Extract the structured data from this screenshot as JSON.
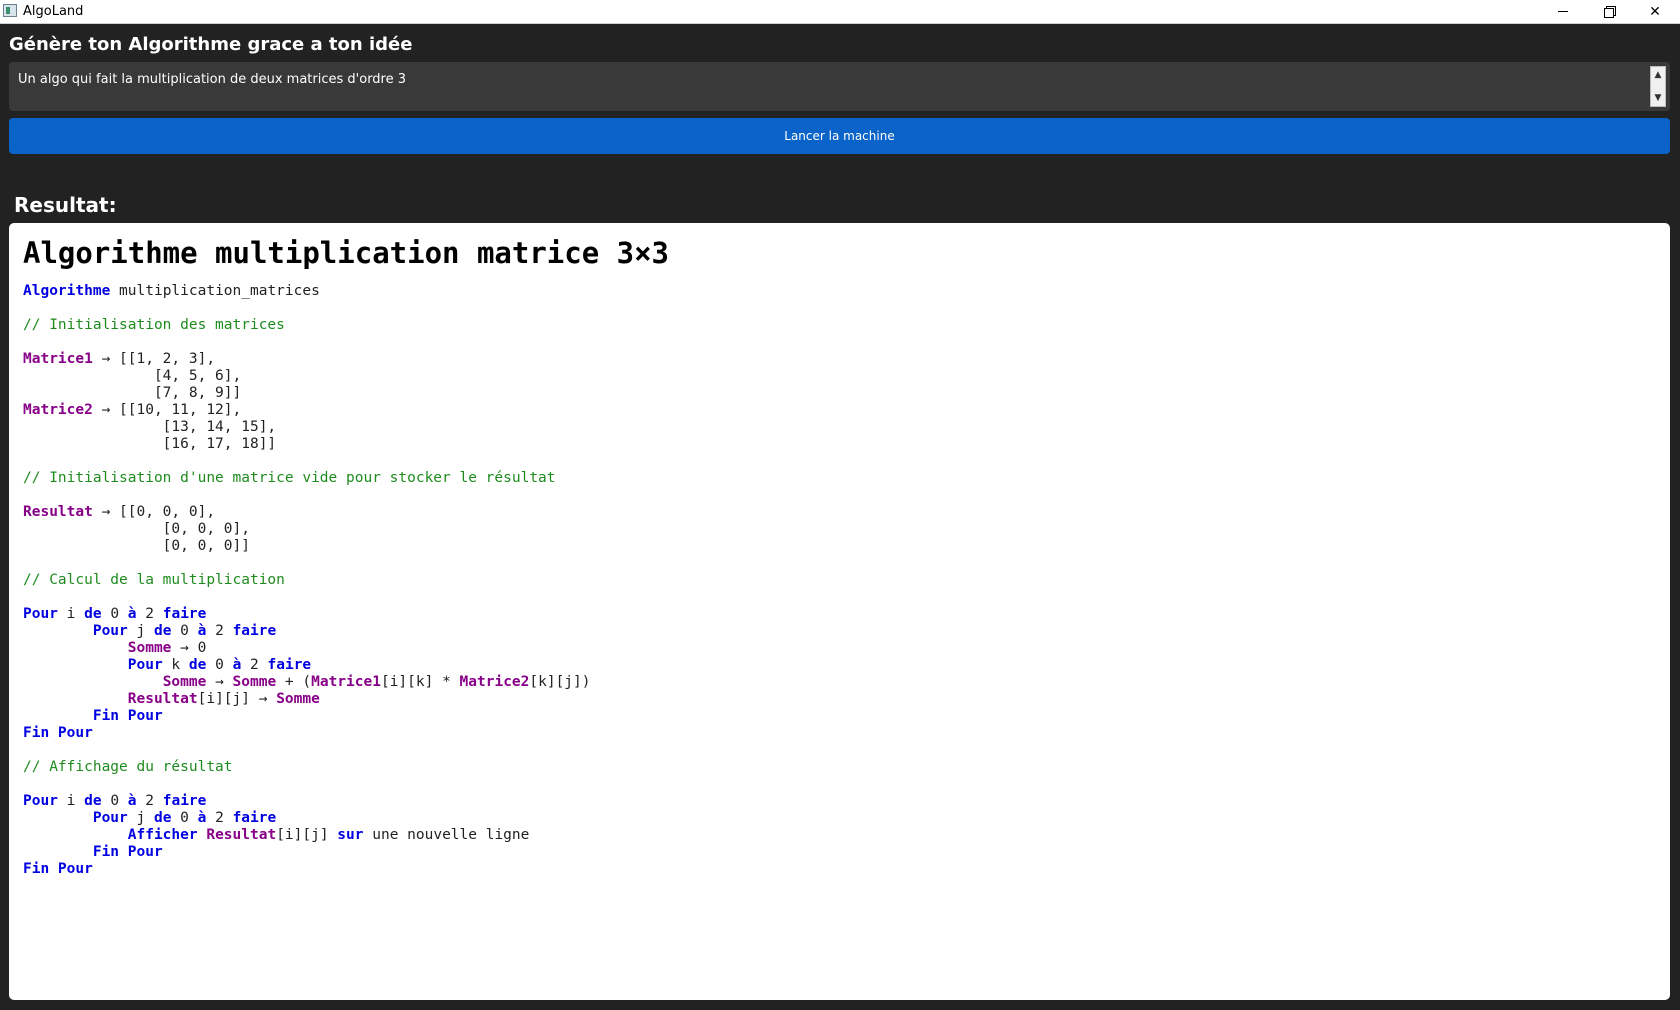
{
  "window": {
    "title": "AlgoLand",
    "icon": "app-window-icon",
    "controls": [
      "minimize-icon",
      "restore-icon",
      "close-icon"
    ]
  },
  "header": {
    "title": "Génère ton Algorithme grace a ton idée",
    "idea_value": "Un algo qui fait la multiplication de deux matrices d'ordre 3",
    "run_button_label": "Lancer la machine"
  },
  "result": {
    "label": "Resultat:",
    "heading": "Algorithme multiplication matrice 3×3",
    "code_lines": [
      [
        [
          "kw",
          "Algorithme"
        ],
        [
          "t",
          " multiplication_matrices"
        ]
      ],
      [],
      [
        [
          "cm",
          "// Initialisation des matrices"
        ]
      ],
      [],
      [
        [
          "var",
          "Matrice1"
        ],
        [
          "t",
          " → [[1, 2, 3],"
        ]
      ],
      [
        [
          "t",
          "               [4, 5, 6],"
        ]
      ],
      [
        [
          "t",
          "               [7, 8, 9]]"
        ]
      ],
      [
        [
          "var",
          "Matrice2"
        ],
        [
          "t",
          " → [[10, 11, 12],"
        ]
      ],
      [
        [
          "t",
          "                [13, 14, 15],"
        ]
      ],
      [
        [
          "t",
          "                [16, 17, 18]]"
        ]
      ],
      [],
      [
        [
          "cm",
          "// Initialisation d'une matrice vide pour stocker le résultat"
        ]
      ],
      [],
      [
        [
          "var",
          "Resultat"
        ],
        [
          "t",
          " → [[0, 0, 0],"
        ]
      ],
      [
        [
          "t",
          "                [0, 0, 0],"
        ]
      ],
      [
        [
          "t",
          "                [0, 0, 0]]"
        ]
      ],
      [],
      [
        [
          "cm",
          "// Calcul de la multiplication"
        ]
      ],
      [],
      [
        [
          "kw",
          "Pour"
        ],
        [
          "t",
          " i "
        ],
        [
          "kw",
          "de"
        ],
        [
          "t",
          " 0 "
        ],
        [
          "kw",
          "à"
        ],
        [
          "t",
          " 2 "
        ],
        [
          "kw",
          "faire"
        ]
      ],
      [
        [
          "t",
          "        "
        ],
        [
          "kw",
          "Pour"
        ],
        [
          "t",
          " j "
        ],
        [
          "kw",
          "de"
        ],
        [
          "t",
          " 0 "
        ],
        [
          "kw",
          "à"
        ],
        [
          "t",
          " 2 "
        ],
        [
          "kw",
          "faire"
        ]
      ],
      [
        [
          "t",
          "            "
        ],
        [
          "var",
          "Somme"
        ],
        [
          "t",
          " → 0"
        ]
      ],
      [
        [
          "t",
          "            "
        ],
        [
          "kw",
          "Pour"
        ],
        [
          "t",
          " k "
        ],
        [
          "kw",
          "de"
        ],
        [
          "t",
          " 0 "
        ],
        [
          "kw",
          "à"
        ],
        [
          "t",
          " 2 "
        ],
        [
          "kw",
          "faire"
        ]
      ],
      [
        [
          "t",
          "                "
        ],
        [
          "var",
          "Somme"
        ],
        [
          "t",
          " → "
        ],
        [
          "var",
          "Somme"
        ],
        [
          "t",
          " + ("
        ],
        [
          "var",
          "Matrice1"
        ],
        [
          "t",
          "[i][k] * "
        ],
        [
          "var",
          "Matrice2"
        ],
        [
          "t",
          "[k][j])"
        ]
      ],
      [
        [
          "t",
          "            "
        ],
        [
          "var",
          "Resultat"
        ],
        [
          "t",
          "[i][j] → "
        ],
        [
          "var",
          "Somme"
        ]
      ],
      [
        [
          "t",
          "        "
        ],
        [
          "kw",
          "Fin Pour"
        ]
      ],
      [
        [
          "kw",
          "Fin Pour"
        ]
      ],
      [],
      [
        [
          "cm",
          "// Affichage du résultat"
        ]
      ],
      [],
      [
        [
          "kw",
          "Pour"
        ],
        [
          "t",
          " i "
        ],
        [
          "kw",
          "de"
        ],
        [
          "t",
          " 0 "
        ],
        [
          "kw",
          "à"
        ],
        [
          "t",
          " 2 "
        ],
        [
          "kw",
          "faire"
        ]
      ],
      [
        [
          "t",
          "        "
        ],
        [
          "kw",
          "Pour"
        ],
        [
          "t",
          " j "
        ],
        [
          "kw",
          "de"
        ],
        [
          "t",
          " 0 "
        ],
        [
          "kw",
          "à"
        ],
        [
          "t",
          " 2 "
        ],
        [
          "kw",
          "faire"
        ]
      ],
      [
        [
          "t",
          "            "
        ],
        [
          "kw",
          "Afficher"
        ],
        [
          "t",
          " "
        ],
        [
          "var",
          "Resultat"
        ],
        [
          "t",
          "[i][j] "
        ],
        [
          "kw",
          "sur"
        ],
        [
          "t",
          " une nouvelle ligne"
        ]
      ],
      [
        [
          "t",
          "        "
        ],
        [
          "kw",
          "Fin Pour"
        ]
      ],
      [
        [
          "kw",
          "Fin Pour"
        ]
      ]
    ]
  },
  "colors": {
    "background": "#222222",
    "input_bg": "#393939",
    "button": "#0a63c9",
    "keyword": "#0000e0",
    "variable": "#880088",
    "comment": "#1f8b1f"
  }
}
